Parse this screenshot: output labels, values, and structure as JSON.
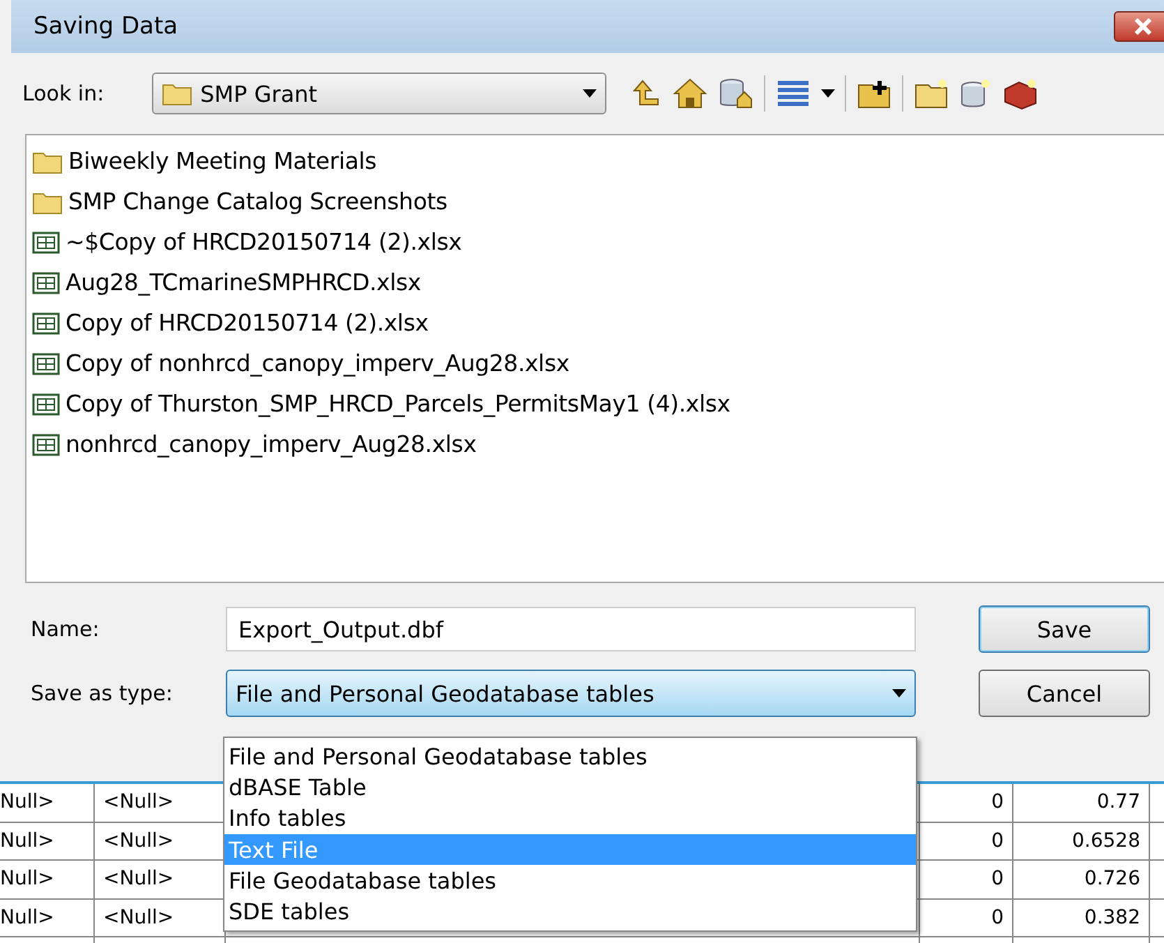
{
  "window": {
    "title": "Saving Data"
  },
  "look_in": {
    "label": "Look in:",
    "value": "SMP Grant"
  },
  "files": [
    {
      "name": "Biweekly Meeting Materials",
      "kind": "folder"
    },
    {
      "name": "SMP Change Catalog Screenshots",
      "kind": "folder"
    },
    {
      "name": "~$Copy of HRCD20150714 (2).xlsx",
      "kind": "table"
    },
    {
      "name": "Aug28_TCmarineSMPHRCD.xlsx",
      "kind": "table"
    },
    {
      "name": "Copy of HRCD20150714 (2).xlsx",
      "kind": "table"
    },
    {
      "name": "Copy of nonhrcd_canopy_imperv_Aug28.xlsx",
      "kind": "table"
    },
    {
      "name": "Copy of Thurston_SMP_HRCD_Parcels_PermitsMay1 (4).xlsx",
      "kind": "table"
    },
    {
      "name": "nonhrcd_canopy_imperv_Aug28.xlsx",
      "kind": "table"
    }
  ],
  "name_field": {
    "label": "Name:",
    "value": "Export_Output.dbf"
  },
  "save_as_type": {
    "label": "Save as type:",
    "value": "File and Personal Geodatabase tables"
  },
  "buttons": [
    {
      "label": "Save",
      "kind": "default"
    },
    {
      "label": "Cancel",
      "kind": "normal"
    }
  ],
  "type_options": [
    {
      "label": "File and Personal Geodatabase tables",
      "selected": false
    },
    {
      "label": "dBASE Table",
      "selected": false
    },
    {
      "label": "Info tables",
      "selected": false
    },
    {
      "label": "Text File",
      "selected": true
    },
    {
      "label": "File Geodatabase tables",
      "selected": false
    },
    {
      "label": "SDE tables",
      "selected": false
    }
  ],
  "background_table": {
    "rows": [
      {
        "cells": [
          "Null>",
          "<Null>",
          "0",
          "0.77"
        ]
      },
      {
        "cells": [
          "Null>",
          "<Null>",
          "0",
          "0.6528"
        ]
      },
      {
        "cells": [
          "Null>",
          "<Null>",
          "0",
          "0.726"
        ]
      },
      {
        "cells": [
          "Null>",
          "<Null>",
          "0",
          "0.382"
        ]
      }
    ]
  }
}
